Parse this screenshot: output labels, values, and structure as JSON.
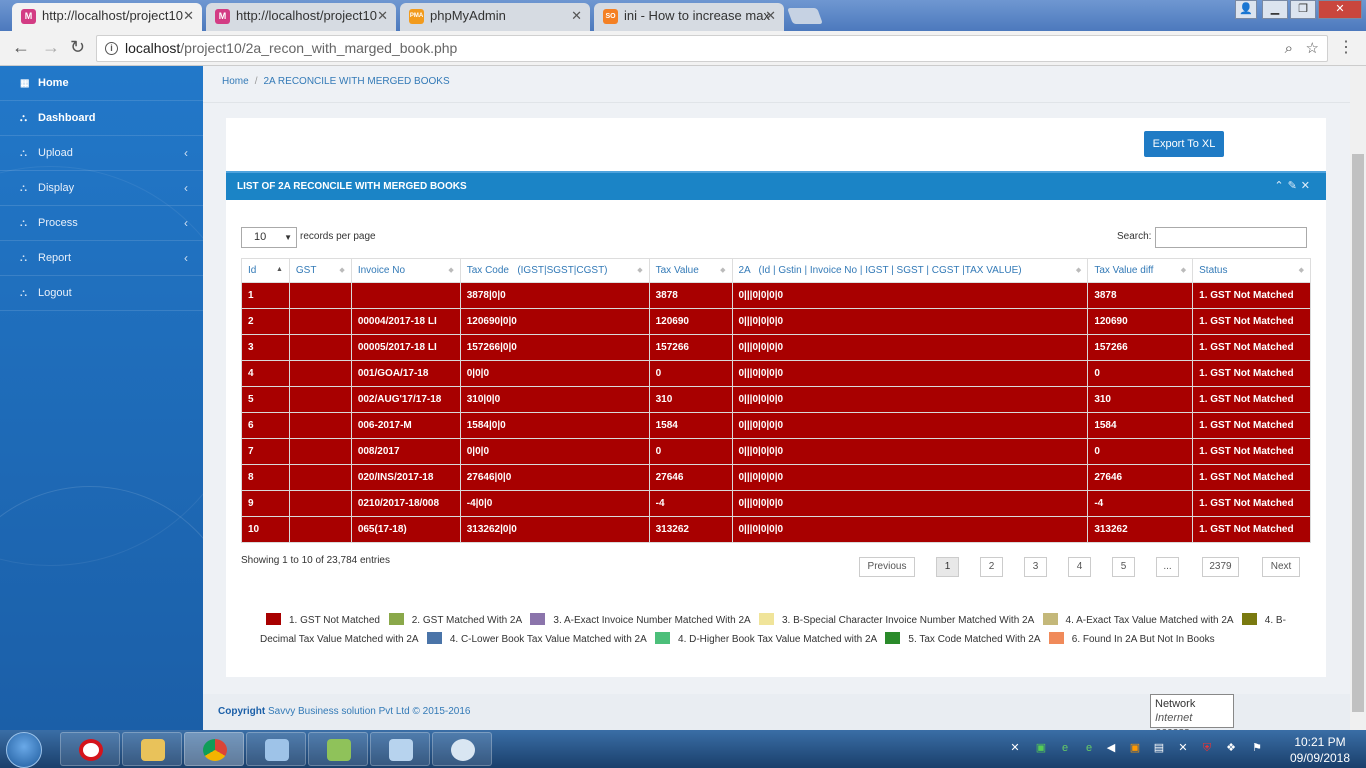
{
  "browser": {
    "tabs": [
      {
        "title": "http://localhost/project10",
        "favicon": "M"
      },
      {
        "title": "http://localhost/project10",
        "favicon": "M"
      },
      {
        "title": "phpMyAdmin",
        "favicon": "PMA"
      },
      {
        "title": "ini - How to increase max",
        "favicon": "SO"
      }
    ],
    "url_host": "localhost",
    "url_path": "/project10/2a_recon_with_marged_book.php"
  },
  "sidebar": {
    "items": [
      {
        "label": "Home",
        "icon": "grid-icon"
      },
      {
        "label": "Dashboard",
        "icon": "sitemap-icon"
      },
      {
        "label": "Upload",
        "icon": "sitemap-icon"
      },
      {
        "label": "Display",
        "icon": "sitemap-icon"
      },
      {
        "label": "Process",
        "icon": "sitemap-icon"
      },
      {
        "label": "Report",
        "icon": "sitemap-icon"
      },
      {
        "label": "Logout",
        "icon": "sitemap-icon"
      }
    ]
  },
  "breadcrumb": {
    "home": "Home",
    "sep": "/",
    "current": "2A RECONCILE WITH MERGED BOOKS"
  },
  "export_label": "Export To XL",
  "portlet_title": "LIST OF 2A RECONCILE WITH MERGED BOOKS",
  "length": {
    "value": "10",
    "label": "records per page"
  },
  "search_label": "Search:",
  "table": {
    "headers": [
      "Id",
      "GST",
      "Invoice No",
      "Tax Code   (IGST|SGST|CGST)",
      "Tax Value",
      "2A   (Id | Gstin | Invoice No | IGST | SGST | CGST |TAX VALUE)",
      "Tax Value diff",
      "Status"
    ],
    "rows": [
      [
        "1",
        "",
        "",
        "3878|0|0",
        "3878",
        "0|||0|0|0|0",
        "3878",
        "1. GST Not Matched"
      ],
      [
        "2",
        "",
        "00004/2017-18 LI",
        "120690|0|0",
        "120690",
        "0|||0|0|0|0",
        "120690",
        "1. GST Not Matched"
      ],
      [
        "3",
        "",
        "00005/2017-18 LI",
        "157266|0|0",
        "157266",
        "0|||0|0|0|0",
        "157266",
        "1. GST Not Matched"
      ],
      [
        "4",
        "",
        "001/GOA/17-18",
        "0|0|0",
        "0",
        "0|||0|0|0|0",
        "0",
        "1. GST Not Matched"
      ],
      [
        "5",
        "",
        "002/AUG'17/17-18",
        "310|0|0",
        "310",
        "0|||0|0|0|0",
        "310",
        "1. GST Not Matched"
      ],
      [
        "6",
        "",
        "006-2017-M",
        "1584|0|0",
        "1584",
        "0|||0|0|0|0",
        "1584",
        "1. GST Not Matched"
      ],
      [
        "7",
        "",
        "008/2017",
        "0|0|0",
        "0",
        "0|||0|0|0|0",
        "0",
        "1. GST Not Matched"
      ],
      [
        "8",
        "",
        "020/INS/2017-18",
        "27646|0|0",
        "27646",
        "0|||0|0|0|0",
        "27646",
        "1. GST Not Matched"
      ],
      [
        "9",
        "",
        "0210/2017-18/008",
        "-4|0|0",
        "-4",
        "0|||0|0|0|0",
        "-4",
        "1. GST Not Matched"
      ],
      [
        "10",
        "",
        "065(17-18)",
        "313262|0|0",
        "313262",
        "0|||0|0|0|0",
        "313262",
        "1. GST Not Matched"
      ]
    ]
  },
  "info": "Showing 1 to 10 of 23,784 entries",
  "pagination": [
    "Previous",
    "1",
    "2",
    "3",
    "4",
    "5",
    "...",
    "2379",
    "Next"
  ],
  "legend": [
    {
      "label": "1. GST Not Matched",
      "color": "#a80000"
    },
    {
      "label": "2. GST Matched With 2A",
      "color": "#8aa84a"
    },
    {
      "label": "3. A-Exact Invoice Number Matched With 2A",
      "color": "#8b74ab"
    },
    {
      "label": "3. B-Special Character Invoice Number Matched With 2A",
      "color": "#f0e49a"
    },
    {
      "label": "4. A-Exact Tax Value Matched with 2A",
      "color": "#c4b87a"
    },
    {
      "label": "4. B-Decimal Tax Value Matched with 2A",
      "color": "#7a7a10"
    },
    {
      "label": "4. C-Lower Book Tax Value Matched with 2A",
      "color": "#4a74a8"
    },
    {
      "label": "4. D-Higher Book Tax Value Matched with 2A",
      "color": "#4cbf7a"
    },
    {
      "label": "5. Tax Code Matched With 2A",
      "color": "#2a8a2a"
    },
    {
      "label": "6. Found In 2A But Not In Books",
      "color": "#f08a5a"
    }
  ],
  "footer": {
    "prefix": "Copyright",
    "text": "Savvy Business solution Pvt Ltd © 2015-2016"
  },
  "tooltip": {
    "title": "Network",
    "sub": "Internet access"
  },
  "clock": {
    "time": "10:21 PM",
    "date": "09/09/2018"
  }
}
